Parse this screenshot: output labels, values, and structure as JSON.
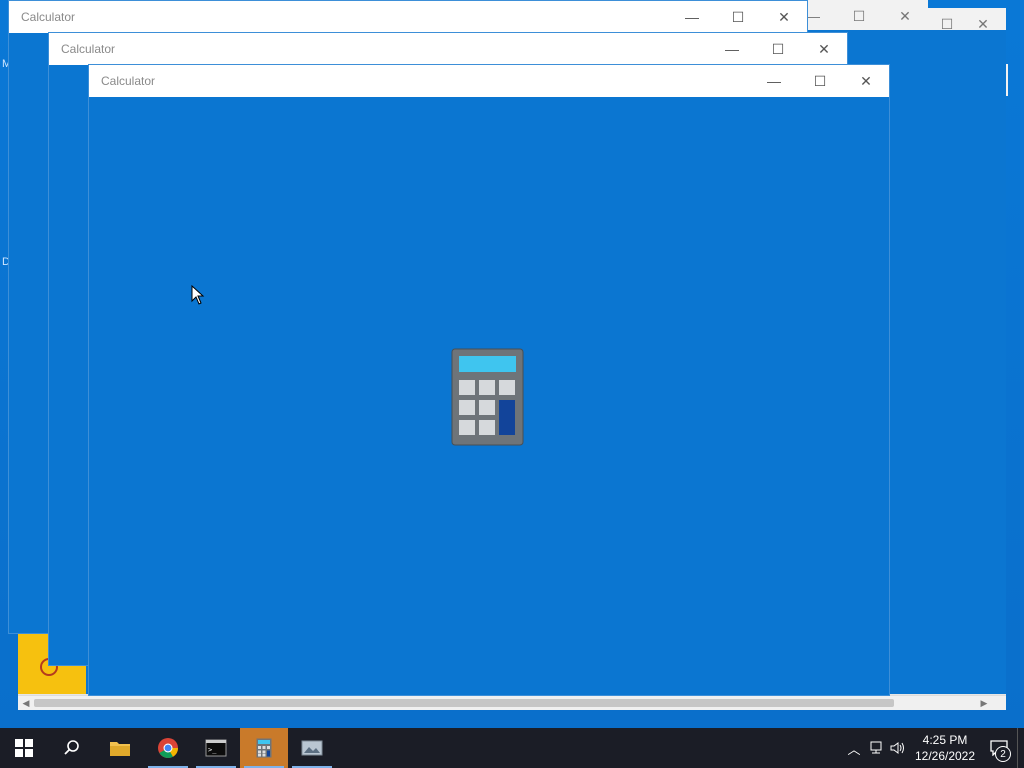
{
  "windows": [
    {
      "title": "Calculator"
    },
    {
      "title": "Calculator"
    },
    {
      "title": "Calculator"
    }
  ],
  "controls": {
    "minimize": "—",
    "maximize": "☐",
    "close": "✕"
  },
  "desktop_edge_chars": [
    "M",
    "D"
  ],
  "taskbar": {
    "items": [
      "start",
      "search",
      "file-explorer",
      "chrome",
      "terminal",
      "calculator",
      "photos"
    ],
    "clock_time": "4:25 PM",
    "clock_date": "12/26/2022",
    "notification_count": "2"
  }
}
